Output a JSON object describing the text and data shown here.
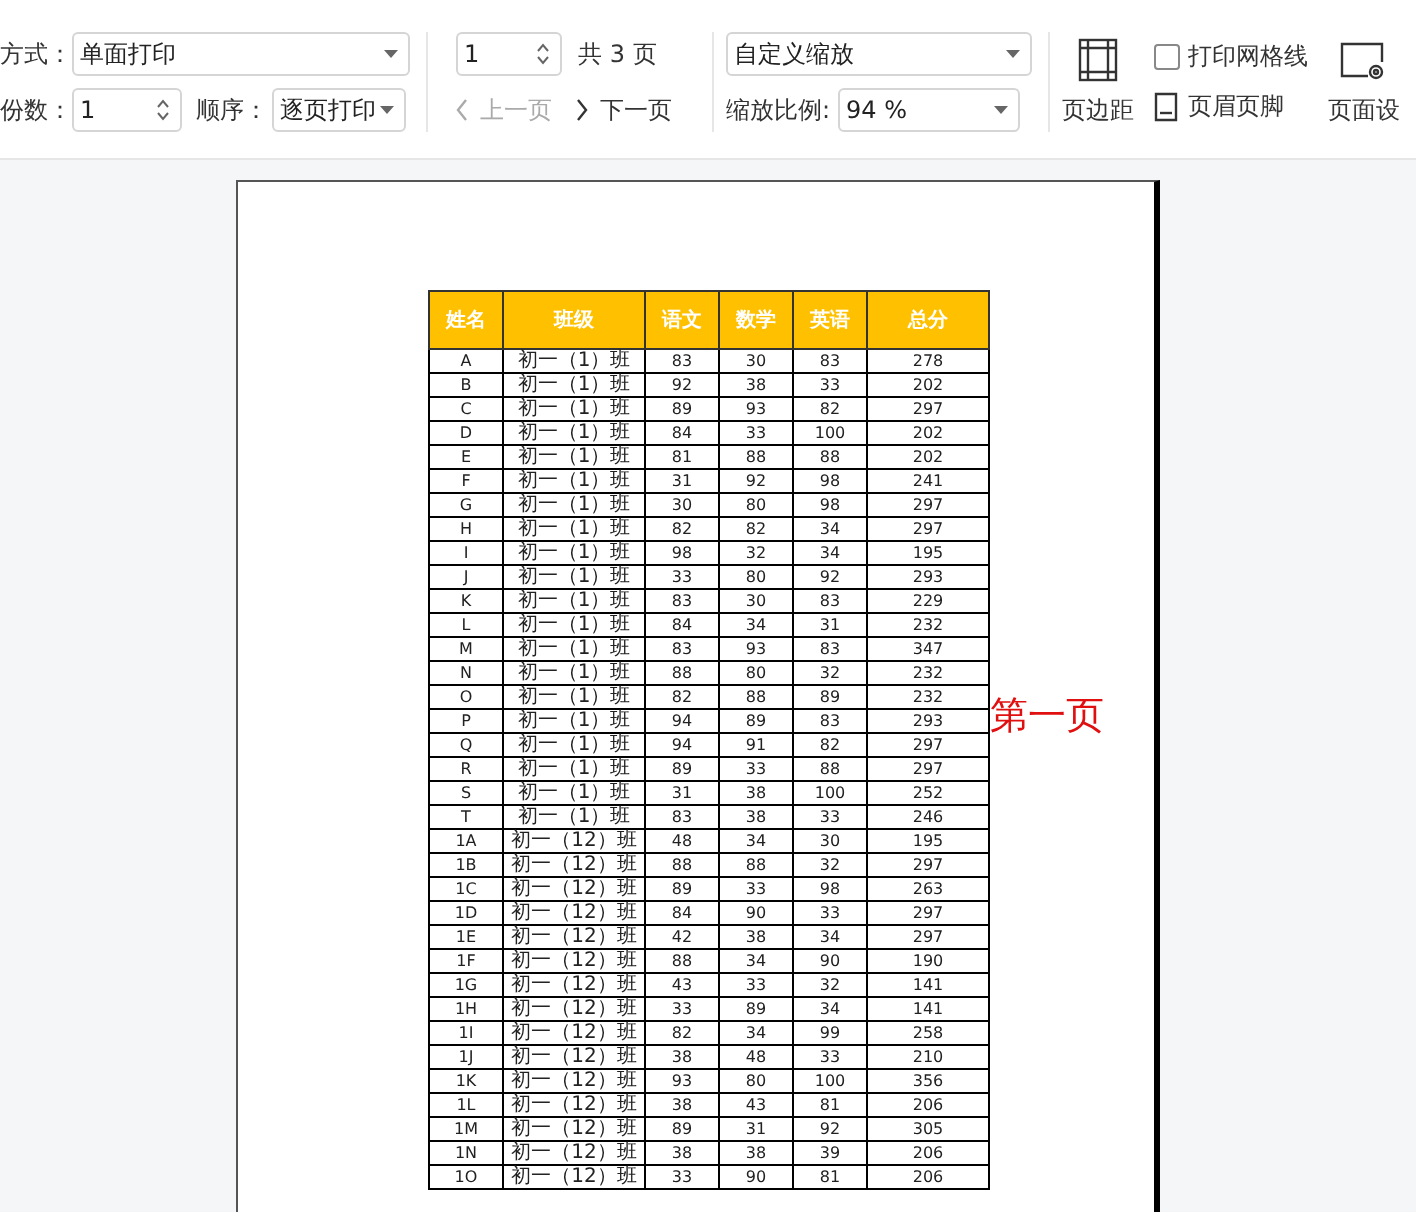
{
  "toolbar": {
    "mode_label": "方式：",
    "mode_select": "单面打印",
    "copies_label": "份数：",
    "copies_value": "1",
    "order_label": "顺序：",
    "order_select": "逐页打印",
    "page_value": "1",
    "total_pages": "共 3 页",
    "prev_page": {
      "label": "上一页",
      "disabled": true
    },
    "next_page": {
      "label": "下一页",
      "disabled": false
    },
    "zoom_select": "自定义缩放",
    "zoom_label": "缩放比例:",
    "zoom_value": "94 %",
    "margins_button": "页边距",
    "gridlines": {
      "label": "打印网格线",
      "checked": false
    },
    "header_footer_button": "页眉页脚",
    "page_setup_button": "页面设"
  },
  "preview": {
    "page_label": "第一页",
    "columns": [
      "姓名",
      "班级",
      "语文",
      "数学",
      "英语",
      "总分"
    ],
    "rows": [
      [
        "A",
        "初一（1）班",
        "83",
        "30",
        "83",
        "278"
      ],
      [
        "B",
        "初一（1）班",
        "92",
        "38",
        "33",
        "202"
      ],
      [
        "C",
        "初一（1）班",
        "89",
        "93",
        "82",
        "297"
      ],
      [
        "D",
        "初一（1）班",
        "84",
        "33",
        "100",
        "202"
      ],
      [
        "E",
        "初一（1）班",
        "81",
        "88",
        "88",
        "202"
      ],
      [
        "F",
        "初一（1）班",
        "31",
        "92",
        "98",
        "241"
      ],
      [
        "G",
        "初一（1）班",
        "30",
        "80",
        "98",
        "297"
      ],
      [
        "H",
        "初一（1）班",
        "82",
        "82",
        "34",
        "297"
      ],
      [
        "I",
        "初一（1）班",
        "98",
        "32",
        "34",
        "195"
      ],
      [
        "J",
        "初一（1）班",
        "33",
        "80",
        "92",
        "293"
      ],
      [
        "K",
        "初一（1）班",
        "83",
        "30",
        "83",
        "229"
      ],
      [
        "L",
        "初一（1）班",
        "84",
        "34",
        "31",
        "232"
      ],
      [
        "M",
        "初一（1）班",
        "83",
        "93",
        "83",
        "347"
      ],
      [
        "N",
        "初一（1）班",
        "88",
        "80",
        "32",
        "232"
      ],
      [
        "O",
        "初一（1）班",
        "82",
        "88",
        "89",
        "232"
      ],
      [
        "P",
        "初一（1）班",
        "94",
        "89",
        "83",
        "293"
      ],
      [
        "Q",
        "初一（1）班",
        "94",
        "91",
        "82",
        "297"
      ],
      [
        "R",
        "初一（1）班",
        "89",
        "33",
        "88",
        "297"
      ],
      [
        "S",
        "初一（1）班",
        "31",
        "38",
        "100",
        "252"
      ],
      [
        "T",
        "初一（1）班",
        "83",
        "38",
        "33",
        "246"
      ],
      [
        "1A",
        "初一（12）班",
        "48",
        "34",
        "30",
        "195"
      ],
      [
        "1B",
        "初一（12）班",
        "88",
        "88",
        "32",
        "297"
      ],
      [
        "1C",
        "初一（12）班",
        "89",
        "33",
        "98",
        "263"
      ],
      [
        "1D",
        "初一（12）班",
        "84",
        "90",
        "33",
        "297"
      ],
      [
        "1E",
        "初一（12）班",
        "42",
        "38",
        "34",
        "297"
      ],
      [
        "1F",
        "初一（12）班",
        "88",
        "34",
        "90",
        "190"
      ],
      [
        "1G",
        "初一（12）班",
        "43",
        "33",
        "32",
        "141"
      ],
      [
        "1H",
        "初一（12）班",
        "33",
        "89",
        "34",
        "141"
      ],
      [
        "1I",
        "初一（12）班",
        "82",
        "34",
        "99",
        "258"
      ],
      [
        "1J",
        "初一（12）班",
        "38",
        "48",
        "33",
        "210"
      ],
      [
        "1K",
        "初一（12）班",
        "93",
        "80",
        "100",
        "356"
      ],
      [
        "1L",
        "初一（12）班",
        "38",
        "43",
        "81",
        "206"
      ],
      [
        "1M",
        "初一（12）班",
        "89",
        "31",
        "92",
        "305"
      ],
      [
        "1N",
        "初一（12）班",
        "38",
        "38",
        "39",
        "206"
      ],
      [
        "1O",
        "初一（12）班",
        "33",
        "90",
        "81",
        "206"
      ]
    ]
  }
}
